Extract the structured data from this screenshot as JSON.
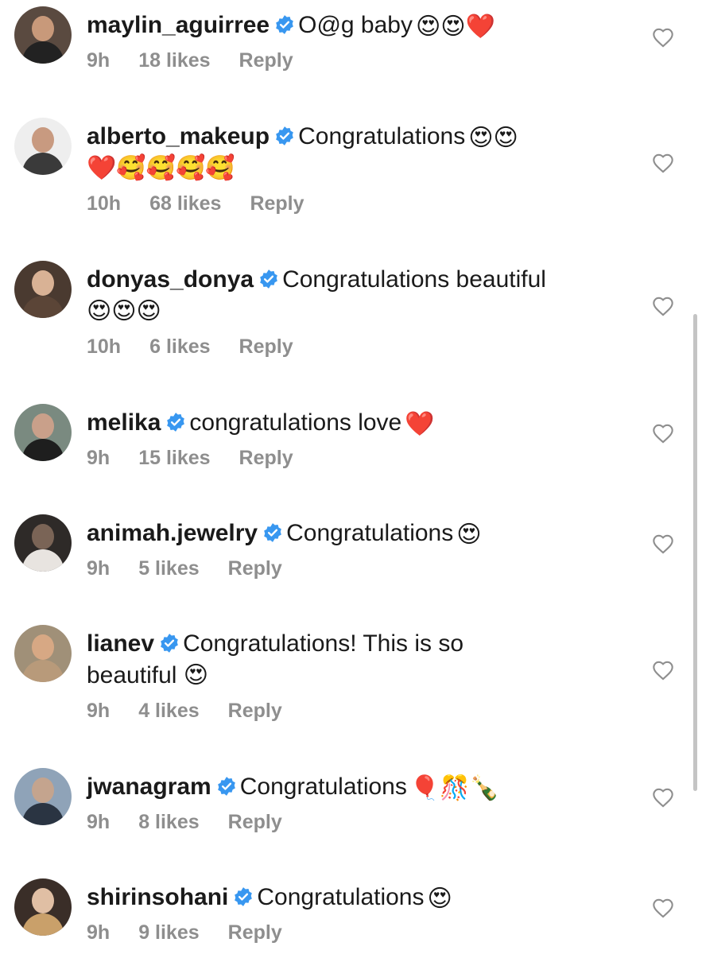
{
  "comments": [
    {
      "username": "maylin_aguirree",
      "text": "O@g baby",
      "emoji": "😍😍❤️",
      "text2": "",
      "time": "9h",
      "likes": "18 likes",
      "reply": "Reply"
    },
    {
      "username": "alberto_makeup",
      "text": "Congratulations",
      "emoji": "😍😍",
      "text2": "❤️🥰🥰🥰🥰",
      "time": "10h",
      "likes": "68 likes",
      "reply": "Reply"
    },
    {
      "username": "donyas_donya",
      "text": "Congratulations beautiful",
      "emoji": "",
      "text2": "😍😍😍",
      "time": "10h",
      "likes": "6 likes",
      "reply": "Reply"
    },
    {
      "username": "melika",
      "text": "congratulations love",
      "emoji": "❤️",
      "text2": "",
      "time": "9h",
      "likes": "15 likes",
      "reply": "Reply"
    },
    {
      "username": "animah.jewelry",
      "text": "Congratulations",
      "emoji": "😍",
      "text2": "",
      "time": "9h",
      "likes": "5 likes",
      "reply": "Reply"
    },
    {
      "username": "lianev",
      "text": "Congratulations! This is so",
      "emoji": "",
      "text2": "beautiful 😍",
      "time": "9h",
      "likes": "4 likes",
      "reply": "Reply"
    },
    {
      "username": "jwanagram",
      "text": "Congratulations",
      "emoji": "🎈🎊🍾",
      "text2": "",
      "time": "9h",
      "likes": "8 likes",
      "reply": "Reply"
    },
    {
      "username": "shirinsohani",
      "text": "Congratulations",
      "emoji": "😍",
      "text2": "",
      "time": "9h",
      "likes": "9 likes",
      "reply": "Reply"
    }
  ],
  "colors": {
    "verified": "#3897f0",
    "meta": "#8e8e8e",
    "text": "#1a1a1a"
  }
}
